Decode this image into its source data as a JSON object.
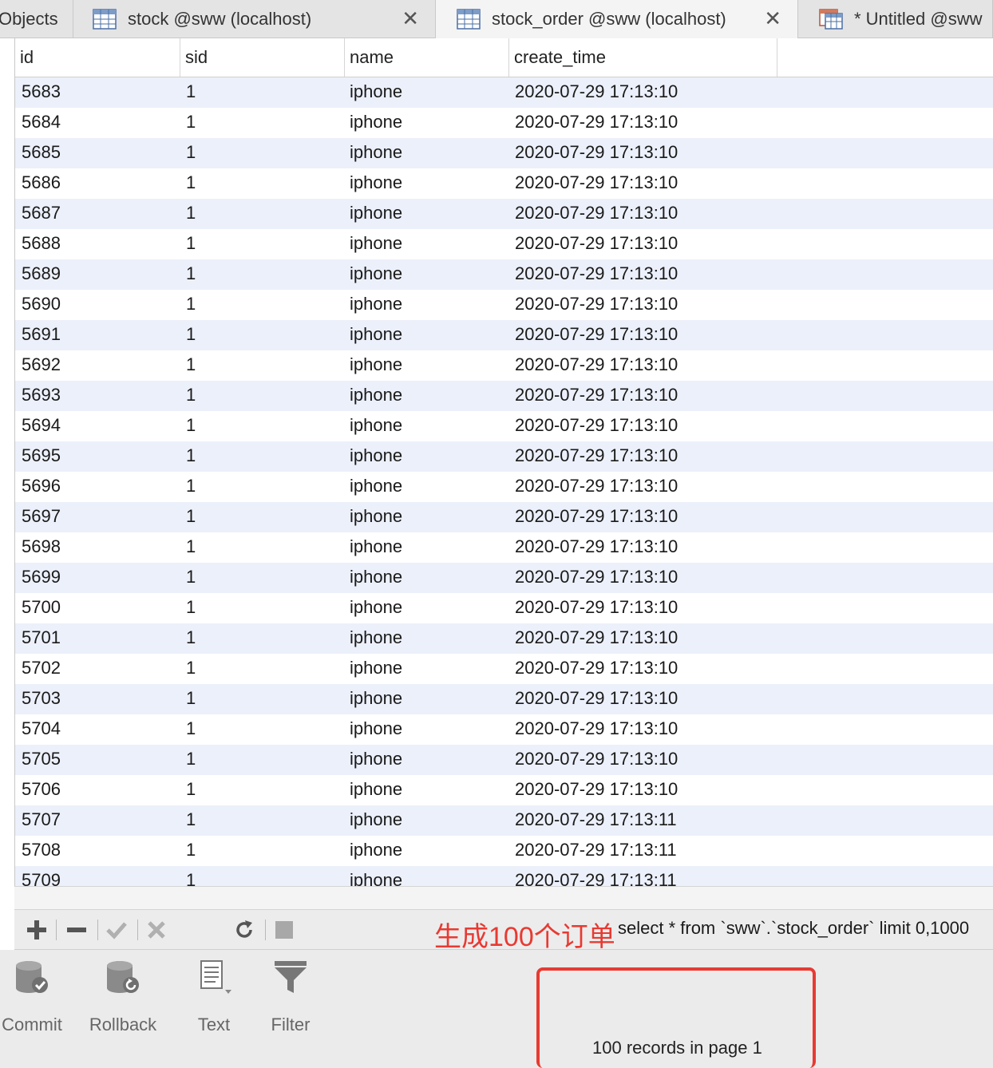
{
  "tabs": [
    {
      "label": "Objects"
    },
    {
      "label": "stock @sww (localhost)",
      "close": "✕"
    },
    {
      "label": "stock_order @sww (localhost)",
      "close": "✕"
    },
    {
      "label": "* Untitled @sww"
    }
  ],
  "table": {
    "columns": [
      "id",
      "sid",
      "name",
      "create_time"
    ],
    "rows": [
      [
        "5683",
        "1",
        "iphone",
        "2020-07-29 17:13:10"
      ],
      [
        "5684",
        "1",
        "iphone",
        "2020-07-29 17:13:10"
      ],
      [
        "5685",
        "1",
        "iphone",
        "2020-07-29 17:13:10"
      ],
      [
        "5686",
        "1",
        "iphone",
        "2020-07-29 17:13:10"
      ],
      [
        "5687",
        "1",
        "iphone",
        "2020-07-29 17:13:10"
      ],
      [
        "5688",
        "1",
        "iphone",
        "2020-07-29 17:13:10"
      ],
      [
        "5689",
        "1",
        "iphone",
        "2020-07-29 17:13:10"
      ],
      [
        "5690",
        "1",
        "iphone",
        "2020-07-29 17:13:10"
      ],
      [
        "5691",
        "1",
        "iphone",
        "2020-07-29 17:13:10"
      ],
      [
        "5692",
        "1",
        "iphone",
        "2020-07-29 17:13:10"
      ],
      [
        "5693",
        "1",
        "iphone",
        "2020-07-29 17:13:10"
      ],
      [
        "5694",
        "1",
        "iphone",
        "2020-07-29 17:13:10"
      ],
      [
        "5695",
        "1",
        "iphone",
        "2020-07-29 17:13:10"
      ],
      [
        "5696",
        "1",
        "iphone",
        "2020-07-29 17:13:10"
      ],
      [
        "5697",
        "1",
        "iphone",
        "2020-07-29 17:13:10"
      ],
      [
        "5698",
        "1",
        "iphone",
        "2020-07-29 17:13:10"
      ],
      [
        "5699",
        "1",
        "iphone",
        "2020-07-29 17:13:10"
      ],
      [
        "5700",
        "1",
        "iphone",
        "2020-07-29 17:13:10"
      ],
      [
        "5701",
        "1",
        "iphone",
        "2020-07-29 17:13:10"
      ],
      [
        "5702",
        "1",
        "iphone",
        "2020-07-29 17:13:10"
      ],
      [
        "5703",
        "1",
        "iphone",
        "2020-07-29 17:13:10"
      ],
      [
        "5704",
        "1",
        "iphone",
        "2020-07-29 17:13:10"
      ],
      [
        "5705",
        "1",
        "iphone",
        "2020-07-29 17:13:10"
      ],
      [
        "5706",
        "1",
        "iphone",
        "2020-07-29 17:13:10"
      ],
      [
        "5707",
        "1",
        "iphone",
        "2020-07-29 17:13:11"
      ],
      [
        "5708",
        "1",
        "iphone",
        "2020-07-29 17:13:11"
      ],
      [
        "5709",
        "1",
        "iphone",
        "2020-07-29 17:13:11"
      ]
    ]
  },
  "toolbar": {
    "icons": [
      "plus-icon",
      "minus-icon",
      "check-icon",
      "cross-icon",
      "refresh-icon",
      "stop-icon"
    ],
    "sql": "select * from `sww`.`stock_order`  limit 0,1000",
    "annotation": "生成100个订单",
    "annotation_color": "#e83a32"
  },
  "bottom": {
    "buttons": [
      {
        "label": "Commit",
        "icon": "database-commit-icon"
      },
      {
        "label": "Rollback",
        "icon": "database-rollback-icon"
      },
      {
        "label": "Text",
        "icon": "text-document-icon"
      },
      {
        "label": "Filter",
        "icon": "filter-funnel-icon"
      }
    ],
    "status": "100 records in page 1"
  }
}
